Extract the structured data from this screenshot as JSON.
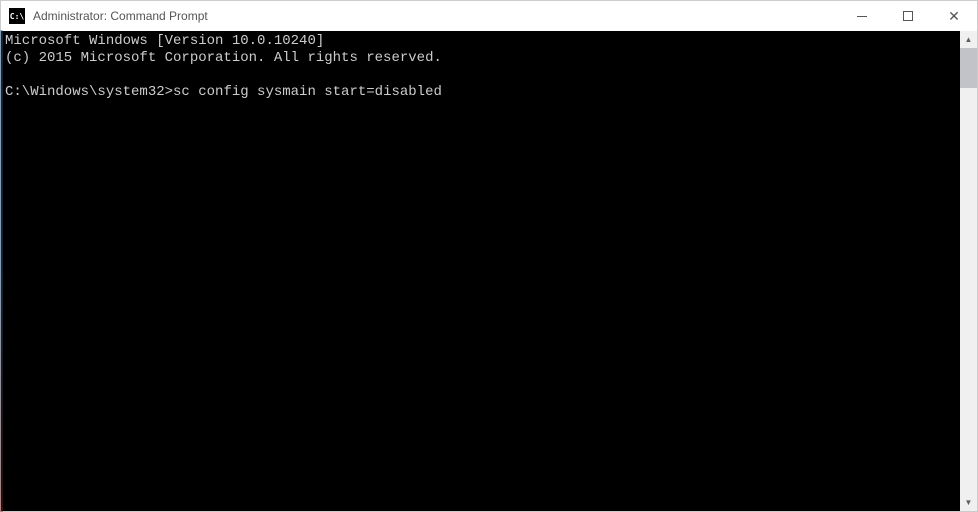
{
  "window": {
    "icon_text": "C:\\",
    "title": "Administrator: Command Prompt"
  },
  "terminal": {
    "line1": "Microsoft Windows [Version 10.0.10240]",
    "line2": "(c) 2015 Microsoft Corporation. All rights reserved.",
    "blank": "",
    "prompt": "C:\\Windows\\system32>",
    "command": "sc config sysmain start=disabled"
  }
}
